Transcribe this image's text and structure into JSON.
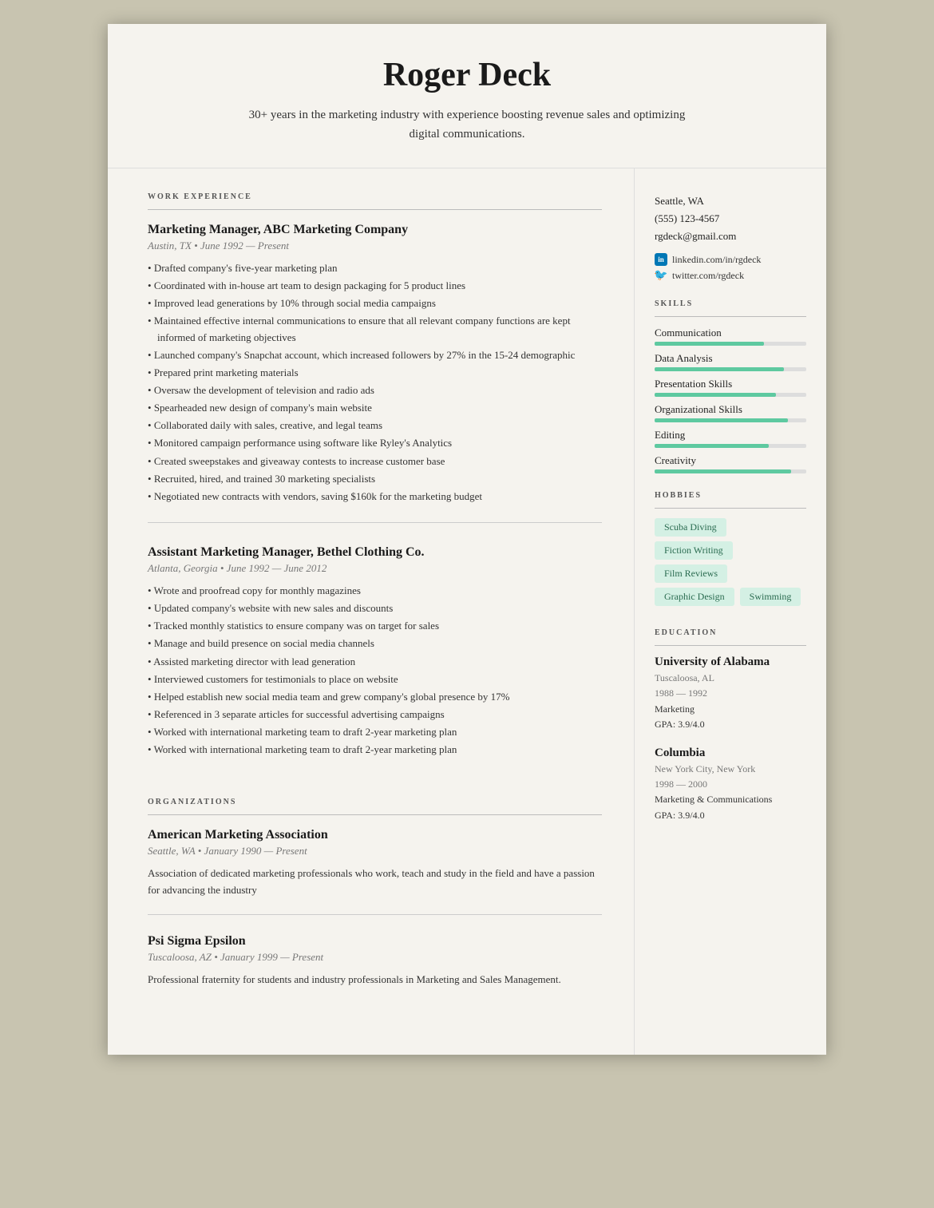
{
  "header": {
    "name": "Roger Deck",
    "tagline": "30+ years in the marketing industry with experience boosting revenue sales and optimizing digital communications."
  },
  "sidebar": {
    "contact": {
      "city": "Seattle, WA",
      "phone": "(555) 123-4567",
      "email": "rgdeck@gmail.com",
      "linkedin": "linkedin.com/in/rgdeck",
      "twitter": "twitter.com/rgdeck"
    },
    "skills": [
      {
        "name": "Communication",
        "level": 72
      },
      {
        "name": "Data Analysis",
        "level": 85
      },
      {
        "name": "Presentation Skills",
        "level": 80
      },
      {
        "name": "Organizational Skills",
        "level": 88
      },
      {
        "name": "Editing",
        "level": 75
      },
      {
        "name": "Creativity",
        "level": 90
      }
    ],
    "hobbies": [
      "Scuba Diving",
      "Fiction Writing",
      "Film Reviews",
      "Graphic Design",
      "Swimming"
    ],
    "education": [
      {
        "school": "University of Alabama",
        "location": "Tuscaloosa, AL",
        "years": "1988 — 1992",
        "field": "Marketing",
        "gpa": "GPA: 3.9/4.0"
      },
      {
        "school": "Columbia",
        "location": "New York City, New York",
        "years": "1998 — 2000",
        "field": "Marketing & Communications",
        "gpa": "GPA: 3.9/4.0"
      }
    ]
  },
  "main": {
    "sections": {
      "work_experience_label": "WORK EXPERIENCE",
      "organizations_label": "ORGANIZATIONS"
    },
    "jobs": [
      {
        "title": "Marketing Manager, ABC Marketing Company",
        "meta": "Austin, TX • June 1992 — Present",
        "bullets": [
          "Drafted company's five-year marketing plan",
          "Coordinated with in-house art team to design packaging for 5 product lines",
          "Improved lead generations by 10% through social media campaigns",
          "Maintained effective internal communications to ensure that all relevant company functions are kept informed of marketing objectives",
          "Launched company's Snapchat account, which increased followers by 27% in the 15-24 demographic",
          "Prepared print marketing materials",
          "Oversaw the development of television and radio ads",
          "Spearheaded new design of company's main website",
          "Collaborated daily with sales, creative, and legal teams",
          "Monitored campaign performance using software like Ryley's Analytics",
          "Created sweepstakes and giveaway contests to increase customer base",
          "Recruited, hired, and trained 30 marketing specialists",
          "Negotiated new contracts with vendors, saving $160k for the marketing budget"
        ]
      },
      {
        "title": "Assistant Marketing Manager, Bethel Clothing Co.",
        "meta": "Atlanta, Georgia • June 1992 — June 2012",
        "bullets": [
          "Wrote and proofread copy for monthly magazines",
          "Updated company's website with new sales and discounts",
          "Tracked monthly statistics to ensure company was on target for sales",
          "Manage and build presence on social media channels",
          "Assisted marketing director with lead generation",
          "Interviewed customers for testimonials to place on website",
          "Helped establish new social media team and grew company's global presence by 17%",
          "Referenced in 3 separate articles for successful advertising campaigns",
          "Worked with international marketing team to draft 2-year marketing plan",
          "Worked with international marketing team to draft 2-year marketing plan"
        ]
      }
    ],
    "organizations": [
      {
        "name": "American Marketing Association",
        "meta": "Seattle, WA • January 1990 — Present",
        "desc": "Association of dedicated marketing professionals who work, teach and study in the field and have a passion for advancing the industry"
      },
      {
        "name": "Psi Sigma Epsilon",
        "meta": "Tuscaloosa, AZ • January 1999 — Present",
        "desc": "Professional fraternity for students and industry professionals in Marketing and Sales Management."
      }
    ]
  }
}
